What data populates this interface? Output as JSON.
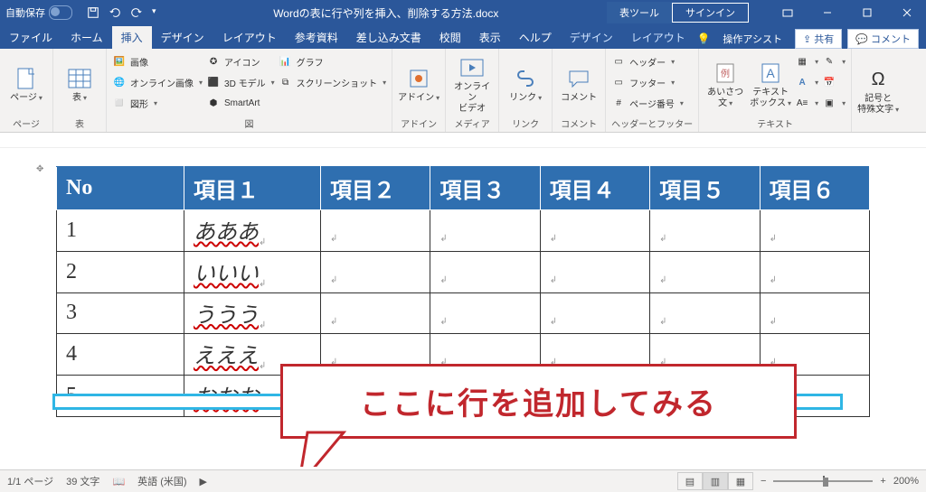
{
  "title": {
    "autosave_label": "自動保存",
    "doc_name": "Wordの表に行や列を挿入、削除する方法.docx",
    "context_tool": "表ツール",
    "signin": "サインイン"
  },
  "tabs": {
    "file": "ファイル",
    "home": "ホーム",
    "insert": "挿入",
    "design": "デザイン",
    "layout": "レイアウト",
    "references": "参考資料",
    "mailings": "差し込み文書",
    "review": "校閲",
    "view": "表示",
    "help": "ヘルプ",
    "ctx_design": "デザイン",
    "ctx_layout": "レイアウト",
    "assist": "操作アシスト",
    "share": "共有",
    "comments": "コメント"
  },
  "ribbon": {
    "pages": {
      "label": "ページ",
      "btn": "ページ"
    },
    "tables": {
      "label": "表",
      "btn": "表"
    },
    "illustrations": {
      "label": "図",
      "picture": "画像",
      "online": "オンライン画像",
      "shapes": "図形",
      "icons": "アイコン",
      "model3d": "3D モデル",
      "smartart": "SmartArt",
      "chart": "グラフ",
      "screenshot": "スクリーンショット"
    },
    "addins": {
      "label": "アドイン",
      "btn": "アドイン"
    },
    "media": {
      "label": "メディア",
      "btn": "オンライン\nビデオ"
    },
    "links": {
      "label": "リンク",
      "btn": "リンク"
    },
    "comments": {
      "label": "コメント",
      "btn": "コメント"
    },
    "headerfooter": {
      "label": "ヘッダーとフッター",
      "header": "ヘッダー",
      "footer": "フッター",
      "pagenum": "ページ番号"
    },
    "text": {
      "label": "テキスト",
      "aisatsu": "あいさつ\n文",
      "textbox": "テキスト\nボックス"
    },
    "symbols": {
      "label": "記号と\n特殊文字",
      "btn": "記号と\n特殊文字"
    }
  },
  "table": {
    "headers": [
      "No",
      "項目１",
      "項目２",
      "項目３",
      "項目４",
      "項目５",
      "項目６"
    ],
    "rows": [
      [
        "1",
        "あああ",
        "",
        "",
        "",
        "",
        ""
      ],
      [
        "2",
        "いいい",
        "",
        "",
        "",
        "",
        ""
      ],
      [
        "3",
        "ううう",
        "",
        "",
        "",
        "",
        ""
      ],
      [
        "4",
        "えええ",
        "",
        "",
        "",
        "",
        ""
      ],
      [
        "5",
        "おおお",
        "",
        "",
        "",
        "",
        ""
      ]
    ]
  },
  "callout": "ここに行を追加してみる",
  "status": {
    "page": "1/1 ページ",
    "words": "39 文字",
    "lang": "英語 (米国)",
    "zoom": "200%"
  }
}
